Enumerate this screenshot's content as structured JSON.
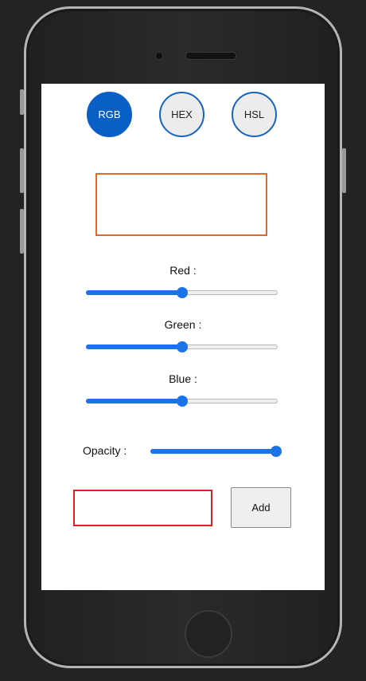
{
  "modes": [
    {
      "label": "RGB",
      "active": true
    },
    {
      "label": "HEX",
      "active": false
    },
    {
      "label": "HSL",
      "active": false
    }
  ],
  "sliders": {
    "red": {
      "label": "Red :",
      "value": 0.5
    },
    "green": {
      "label": "Green :",
      "value": 0.5
    },
    "blue": {
      "label": "Blue :",
      "value": 0.5
    },
    "opacity": {
      "label": "Opacity :",
      "value": 1.0
    }
  },
  "color_name_input": {
    "value": "",
    "placeholder": ""
  },
  "add_button": {
    "label": "Add"
  },
  "colors": {
    "accent": "#1a73e8",
    "active_mode": "#0a5fc7",
    "preview_border": "#e06a2e",
    "input_border": "#e02020"
  }
}
